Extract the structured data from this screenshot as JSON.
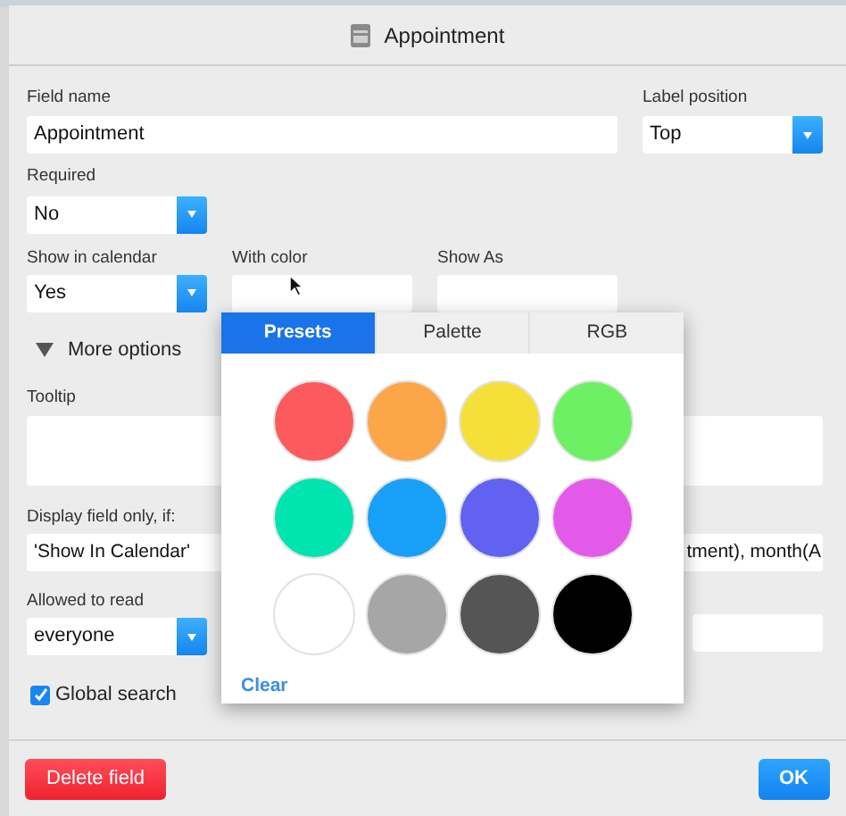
{
  "window": {
    "title": "Appointment"
  },
  "form": {
    "field_name": {
      "label": "Field name",
      "value": "Appointment"
    },
    "label_position": {
      "label": "Label position",
      "value": "Top"
    },
    "required": {
      "label": "Required",
      "value": "No"
    },
    "show_in_calendar": {
      "label": "Show in calendar",
      "value": "Yes"
    },
    "with_color": {
      "label": "With color"
    },
    "show_as": {
      "label": "Show As"
    },
    "more_options": {
      "label": "More options",
      "expanded": true
    },
    "tooltip": {
      "label": "Tooltip"
    },
    "display_if": {
      "label": "Display field only, if:",
      "value_start": "'Show In Calendar'",
      "value_end": "tment), month(A"
    },
    "allowed_to_read": {
      "label": "Allowed to read",
      "value": "everyone"
    },
    "global_search": {
      "label": "Global search",
      "checked": true
    }
  },
  "color_popup": {
    "tabs": [
      {
        "label": "Presets",
        "selected": true
      },
      {
        "label": "Palette",
        "selected": false
      },
      {
        "label": "RGB",
        "selected": false
      }
    ],
    "swatches": [
      {
        "color": "#fc5a5c"
      },
      {
        "color": "#fca64a"
      },
      {
        "color": "#f5e03a"
      },
      {
        "color": "#6ef064"
      },
      {
        "color": "#00e4b0"
      },
      {
        "color": "#18a0f8"
      },
      {
        "color": "#6262f2"
      },
      {
        "color": "#e45ae8"
      },
      {
        "color": "#ffffff"
      },
      {
        "color": "#a6a6a6"
      },
      {
        "color": "#555555"
      },
      {
        "color": "#000000"
      }
    ],
    "clear": "Clear"
  },
  "buttons": {
    "delete": "Delete field",
    "ok": "OK"
  }
}
